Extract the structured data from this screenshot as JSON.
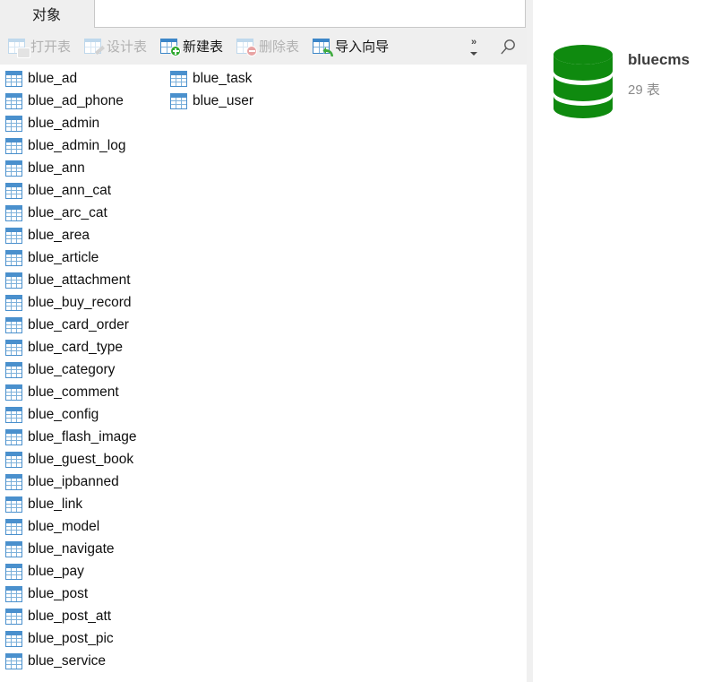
{
  "tabstrip": {
    "active_tab": "对象",
    "field_value": ""
  },
  "toolbar": {
    "buttons": [
      {
        "label": "打开表",
        "icon": "open-table-icon",
        "enabled": false
      },
      {
        "label": "设计表",
        "icon": "design-table-icon",
        "enabled": false
      },
      {
        "label": "新建表",
        "icon": "new-table-icon",
        "enabled": true
      },
      {
        "label": "删除表",
        "icon": "delete-table-icon",
        "enabled": false
      },
      {
        "label": "导入向导",
        "icon": "import-wizard-icon",
        "enabled": true
      }
    ],
    "overflow_glyph": "»",
    "search_icon": "search-icon"
  },
  "table_list": {
    "column_1": [
      "blue_ad",
      "blue_ad_phone",
      "blue_admin",
      "blue_admin_log",
      "blue_ann",
      "blue_ann_cat",
      "blue_arc_cat",
      "blue_area",
      "blue_article",
      "blue_attachment",
      "blue_buy_record",
      "blue_card_order",
      "blue_card_type",
      "blue_category",
      "blue_comment",
      "blue_config",
      "blue_flash_image",
      "blue_guest_book",
      "blue_ipbanned",
      "blue_link",
      "blue_model",
      "blue_navigate",
      "blue_pay",
      "blue_post",
      "blue_post_att",
      "blue_post_pic",
      "blue_service"
    ],
    "column_2": [
      "blue_task",
      "blue_user"
    ]
  },
  "info_panel": {
    "database_icon": "database-cylinder-icon",
    "database_name": "bluecms",
    "table_count_label": "29 表"
  },
  "colors": {
    "toolbar_bg": "#efefef",
    "table_icon_blue": "#4a90cd",
    "database_green": "#0f8a0f",
    "panel_white": "#ffffff",
    "muted_text": "#8a8a8a",
    "disabled_text": "#b1b1b1"
  }
}
